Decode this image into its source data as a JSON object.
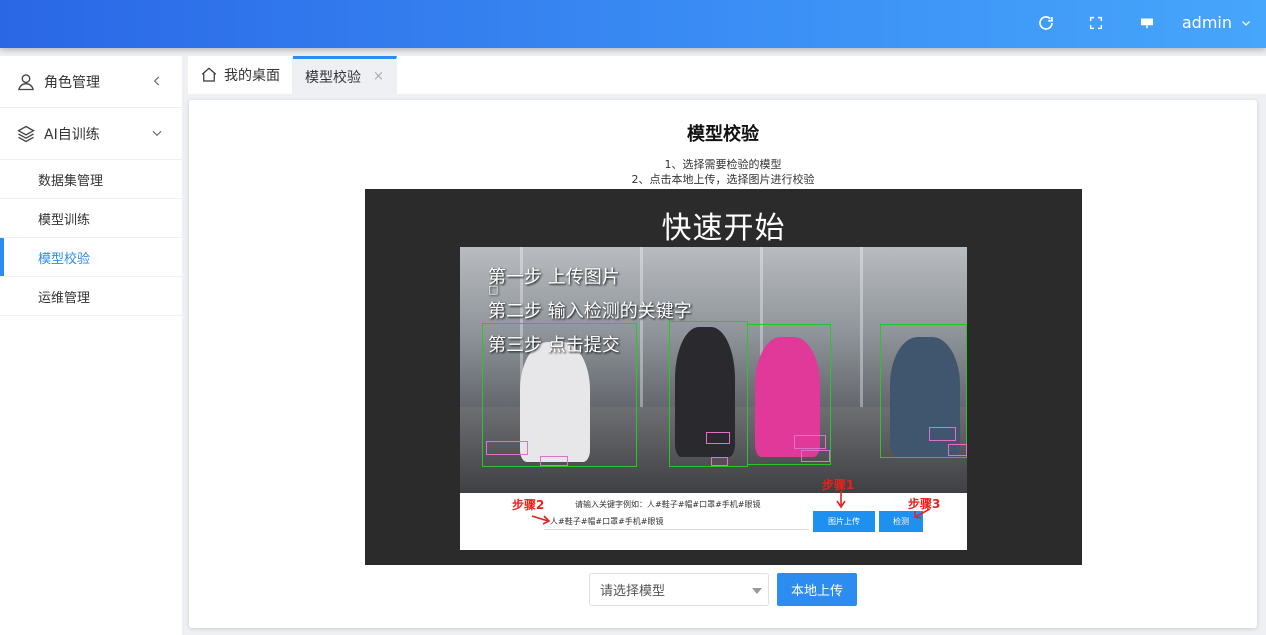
{
  "header": {
    "refresh_icon": "refresh-icon",
    "fullscreen_icon": "fullscreen-icon",
    "screen_icon": "screen-icon",
    "user_name": "admin"
  },
  "sidebar": {
    "groups": [
      {
        "label": "角色管理",
        "icon": "user-icon",
        "expanded": false
      },
      {
        "label": "AI自训练",
        "icon": "layers-icon",
        "expanded": true
      }
    ],
    "sub_items": [
      {
        "label": "数据集管理",
        "active": false
      },
      {
        "label": "模型训练",
        "active": false
      },
      {
        "label": "模型校验",
        "active": true
      },
      {
        "label": "运维管理",
        "active": false
      }
    ]
  },
  "tabs": [
    {
      "label": "我的桌面",
      "icon": "home-icon",
      "active": false
    },
    {
      "label": "模型校验",
      "active": true,
      "close": "×"
    }
  ],
  "main": {
    "title": "模型校验",
    "steps": [
      "1、选择需要检验的模型",
      "2、点击本地上传，选择图片进行校验"
    ],
    "demo": {
      "title": "快速开始",
      "lines": [
        "第一步 上传图片",
        "□",
        "第二步 输入检测的关键字",
        "第三步 点击提交"
      ],
      "mock_hint": "请输入关键字例如：人#鞋子#帽#口罩#手机#眼镜",
      "mock_input": "人#鞋子#帽#口罩#手机#眼镜",
      "mock_upload_btn": "图片上传",
      "mock_detect_btn": "检测",
      "step1": "步骤1",
      "step2": "步骤2",
      "step3": "步骤3"
    },
    "select_placeholder": "请选择模型",
    "upload_button": "本地上传"
  },
  "colors": {
    "accent": "#2d8cf0",
    "header_start": "#2a67e6",
    "header_end": "#46a6fb",
    "bbox": "#27c62a",
    "small_box": "#e06fd0",
    "annotation_red": "#e8211b"
  }
}
